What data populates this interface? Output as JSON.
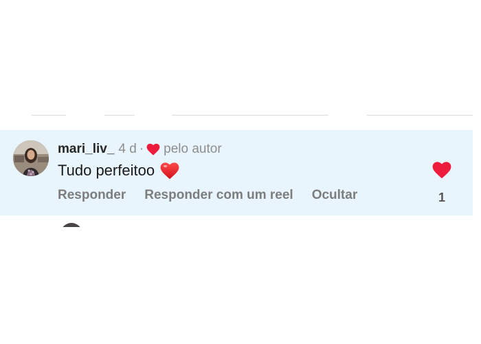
{
  "comment": {
    "username": "mari_liv_",
    "time": "4 d",
    "separator": "·",
    "liked_by_author": "pelo autor",
    "text": "Tudo perfeitoo",
    "actions": {
      "reply": "Responder",
      "reply_reel": "Responder com um reel",
      "hide": "Ocultar"
    },
    "like_count": "1"
  },
  "icons": {
    "author_heart": "heart-icon",
    "emoji": "red-heart-emoji",
    "like": "heart-filled-icon"
  },
  "colors": {
    "highlight_bg": "#e8f5fd",
    "heart_red": "#ed1c3c",
    "username": "#262626",
    "secondary": "#8e8e8e"
  }
}
